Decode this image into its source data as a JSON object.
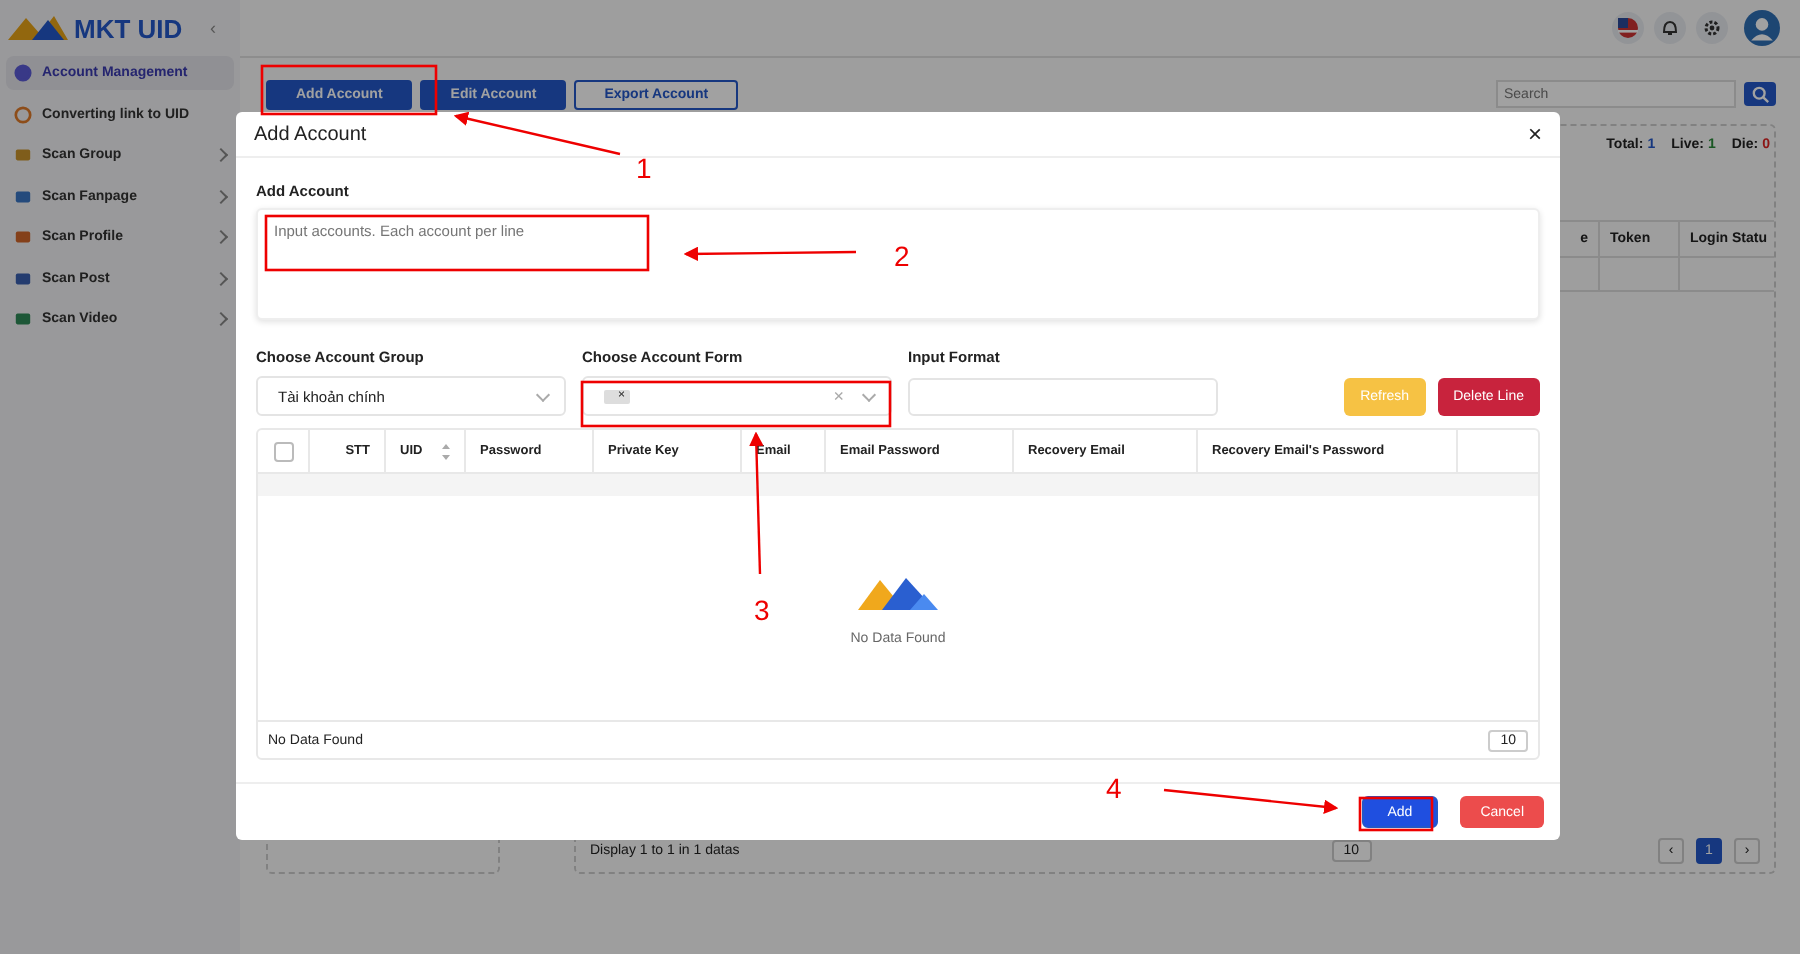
{
  "sidebar": {
    "logo": "MKT UID",
    "collapse": "‹",
    "items": [
      {
        "label": "Account Management",
        "selected": true,
        "expandable": false
      },
      {
        "label": "Converting link to UID",
        "selected": false,
        "expandable": false
      },
      {
        "label": "Scan Group",
        "selected": false,
        "expandable": true
      },
      {
        "label": "Scan Fanpage",
        "selected": false,
        "expandable": true
      },
      {
        "label": "Scan Profile",
        "selected": false,
        "expandable": true
      },
      {
        "label": "Scan Post",
        "selected": false,
        "expandable": true
      },
      {
        "label": "Scan Video",
        "selected": false,
        "expandable": true
      }
    ]
  },
  "toolbar": {
    "buttons": [
      {
        "label": "Add Account",
        "kind": "primary"
      },
      {
        "label": "Edit Account",
        "kind": "primary"
      },
      {
        "label": "Export Account",
        "kind": "outline"
      }
    ],
    "search": {
      "placeholder": "Search"
    }
  },
  "summary": {
    "total_label": "Total:",
    "total": "1",
    "live_label": "Live:",
    "live": "1",
    "die_label": "Die:",
    "die": "0"
  },
  "background_table": {
    "columns": [
      "e",
      "Token",
      "Login Statu"
    ],
    "footer": "Display 1 to 1 in 1 datas",
    "page_size": "10",
    "pages": [
      {
        "label": "1",
        "selected": true
      }
    ],
    "prev": "‹",
    "next": "›"
  },
  "modal": {
    "title": "Add Account",
    "close": "×",
    "input_label": "Add Account",
    "input_placeholder": "Input accounts. Each account per line",
    "group_label": "Choose Account Group",
    "group_value": "Tài khoản chính",
    "form_label": "Choose Account Form",
    "form_tag": "×",
    "form_clear": "×",
    "format_label": "Input Format",
    "actions": [
      {
        "label": "Refresh",
        "kind": "warning"
      },
      {
        "label": "Delete Line",
        "kind": "danger"
      }
    ],
    "table": {
      "checked": false,
      "columns": [
        {
          "label": "STT",
          "sortable": false
        },
        {
          "label": "UID",
          "sortable": true
        },
        {
          "label": "Password",
          "sortable": false
        },
        {
          "label": "Private Key",
          "sortable": false
        },
        {
          "label": "Email",
          "sortable": false
        },
        {
          "label": "Email Password",
          "sortable": false
        },
        {
          "label": "Recovery Email",
          "sortable": false
        },
        {
          "label": "Recovery Email's Password",
          "sortable": false
        }
      ],
      "empty": "No Data Found",
      "footer": "No Data Found",
      "page_size": "10"
    },
    "footer_buttons": [
      {
        "label": "Add",
        "kind": "primary"
      },
      {
        "label": "Cancel",
        "kind": "danger"
      }
    ]
  },
  "annotations": [
    {
      "label": "1"
    },
    {
      "label": "2"
    },
    {
      "label": "3"
    },
    {
      "label": "4"
    }
  ]
}
